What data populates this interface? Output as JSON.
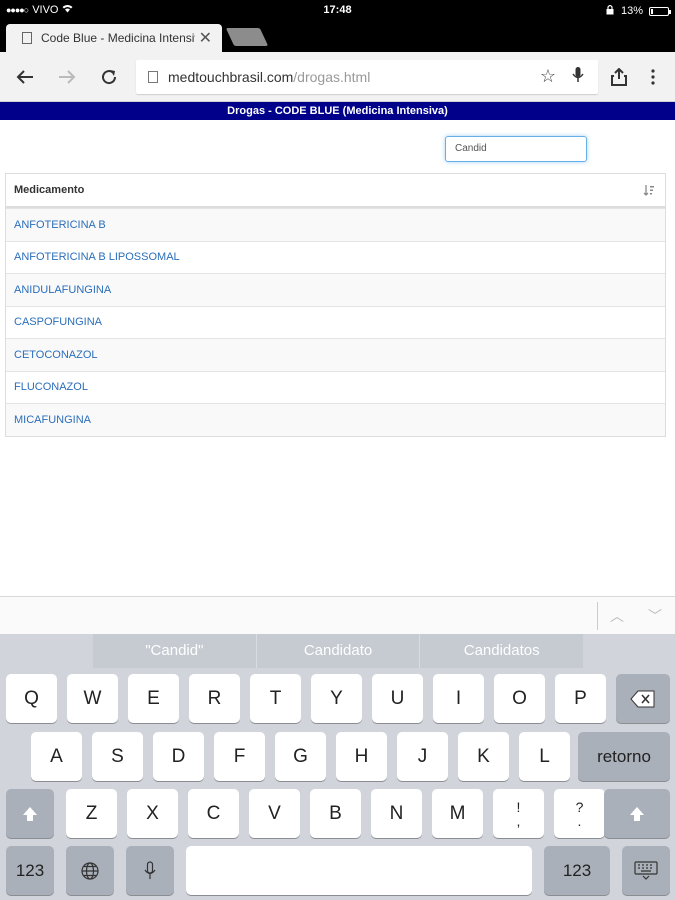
{
  "status_bar": {
    "carrier": "VIVO",
    "time": "17:48",
    "battery": "13%",
    "battery_level": 0.13
  },
  "browser": {
    "tab_title": "Code Blue - Medicina Intensiva",
    "url_host": "medtouchbrasil.com",
    "url_path": "/drogas.html"
  },
  "page": {
    "banner": "Drogas - CODE BLUE (Medicina Intensiva)",
    "search_value": "Candid",
    "table": {
      "header": "Medicamento",
      "rows": [
        "ANFOTERICINA B",
        "ANFOTERICINA B LIPOSSOMAL",
        "ANIDULAFUNGINA",
        "CASPOFUNGINA",
        "CETOCONAZOL",
        "FLUCONAZOL",
        "MICAFUNGINA"
      ]
    }
  },
  "keyboard": {
    "suggestions": [
      "\"Candid\"",
      "Candidato",
      "Candidatos"
    ],
    "row1": [
      "Q",
      "W",
      "E",
      "R",
      "T",
      "Y",
      "U",
      "I",
      "O",
      "P"
    ],
    "row2": [
      "A",
      "S",
      "D",
      "F",
      "G",
      "H",
      "J",
      "K",
      "L"
    ],
    "return_label": "retorno",
    "row3": [
      "Z",
      "X",
      "C",
      "V",
      "B",
      "N",
      "M"
    ],
    "punct1_top": "!",
    "punct1_bottom": ",",
    "punct2_top": "?",
    "punct2_bottom": ".",
    "numbers_label": "123"
  },
  "colors": {
    "banner_bg": "#00008b",
    "link": "#2a6ebb"
  },
  "icons": [
    "back-arrow-icon",
    "forward-arrow-icon",
    "reload-icon",
    "document-icon",
    "star-icon",
    "mic-icon",
    "share-icon",
    "menu-icon",
    "sort-icon",
    "shift-icon",
    "backspace-icon",
    "globe-icon",
    "keyboard-hide-icon",
    "chevron-up-icon",
    "chevron-down-icon",
    "wifi-icon",
    "lock-rotation-icon"
  ]
}
